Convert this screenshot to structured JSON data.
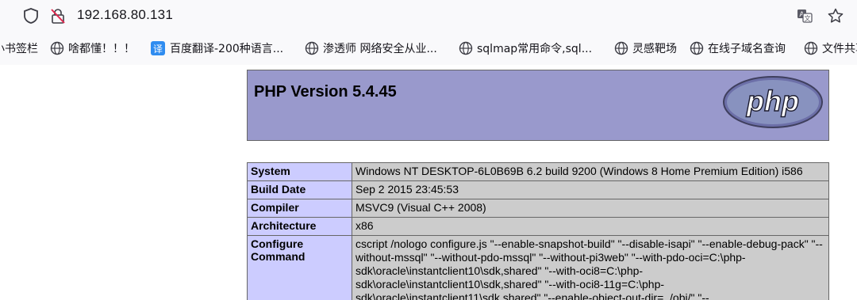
{
  "browser": {
    "url": "192.168.80.131",
    "icons": [
      "shield-icon",
      "insecure-connection-icon",
      "translate-icon",
      "bookmark-star-icon"
    ]
  },
  "bookmarks": [
    {
      "label": "小书签栏",
      "icon": "none"
    },
    {
      "label": "啥都懂！！！",
      "icon": "globe-icon"
    },
    {
      "label": "百度翻译-200种语言...",
      "icon": "fanyi-icon",
      "icon_text": "译"
    },
    {
      "label": "渗透师 网络安全从业...",
      "icon": "globe-icon"
    },
    {
      "label": "sqlmap常用命令,sql...",
      "icon": "globe-icon"
    },
    {
      "label": "灵感靶场",
      "icon": "globe-icon"
    },
    {
      "label": "在线子域名查询",
      "icon": "globe-icon"
    },
    {
      "label": "文件共享",
      "icon": "globe-icon"
    }
  ],
  "phpinfo": {
    "title": "PHP Version 5.4.45",
    "logo_text": "php",
    "colors": {
      "header": "#9999cc",
      "key": "#ccccff",
      "value": "#cccccc",
      "border": "#666666"
    },
    "rows": [
      {
        "key": "System",
        "value": "Windows NT DESKTOP-6L0B69B 6.2 build 9200 (Windows 8 Home Premium Edition) i586"
      },
      {
        "key": "Build Date",
        "value": "Sep 2 2015 23:45:53"
      },
      {
        "key": "Compiler",
        "value": "MSVC9 (Visual C++ 2008)"
      },
      {
        "key": "Architecture",
        "value": "x86"
      },
      {
        "key": "Configure Command",
        "value": "cscript /nologo configure.js \"--enable-snapshot-build\" \"--disable-isapi\" \"--enable-debug-pack\" \"--without-mssql\" \"--without-pdo-mssql\" \"--without-pi3web\" \"--with-pdo-oci=C:\\php-sdk\\oracle\\instantclient10\\sdk,shared\" \"--with-oci8=C:\\php-sdk\\oracle\\instantclient10\\sdk,shared\" \"--with-oci8-11g=C:\\php-sdk\\oracle\\instantclient11\\sdk,shared\" \"--enable-object-out-dir=../obj/\" \"--"
      }
    ]
  }
}
